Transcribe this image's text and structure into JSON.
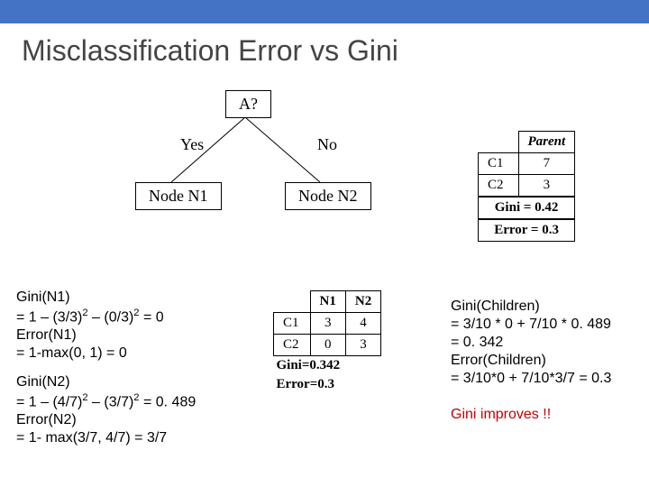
{
  "title": "Misclassification Error vs Gini",
  "tree": {
    "root": "A?",
    "yes": "Yes",
    "no": "No",
    "n1": "Node N1",
    "n2": "Node N2"
  },
  "parent_table": {
    "header": "Parent",
    "rows": [
      {
        "cls": "C1",
        "val": "7"
      },
      {
        "cls": "C2",
        "val": "3"
      }
    ],
    "gini_label": "Gini = 0.42",
    "error_label": "Error = 0.3"
  },
  "children_table": {
    "col1": "N1",
    "col2": "N2",
    "rows": [
      {
        "cls": "C1",
        "v1": "3",
        "v2": "4"
      },
      {
        "cls": "C2",
        "v1": "0",
        "v2": "3"
      }
    ],
    "gini_label": "Gini=0.342",
    "error_label": "Error=0.3"
  },
  "calc_n1": {
    "l1": "Gini(N1)",
    "l2a": "= 1 – (3/3)",
    "l2b": " – (0/3)",
    "l2c": "  = 0",
    "l3": "Error(N1)",
    "l4": "= 1-max(0, 1) = 0"
  },
  "calc_n2": {
    "l1": "Gini(N2)",
    "l2a": "= 1 – (4/7)",
    "l2b": " – (3/7)",
    "l2c": " = 0. 489",
    "l3": "Error(N2)",
    "l4": "= 1- max(3/7, 4/7) = 3/7"
  },
  "calc_children": {
    "l1": "Gini(Children)",
    "l2": "= 3/10 * 0 + 7/10 * 0. 489",
    "l3": "= 0. 342",
    "l4": "Error(Children)",
    "l5": "= 3/10*0 + 7/10*3/7 = 0.3"
  },
  "improves": "Gini improves !!",
  "sup2": "2"
}
